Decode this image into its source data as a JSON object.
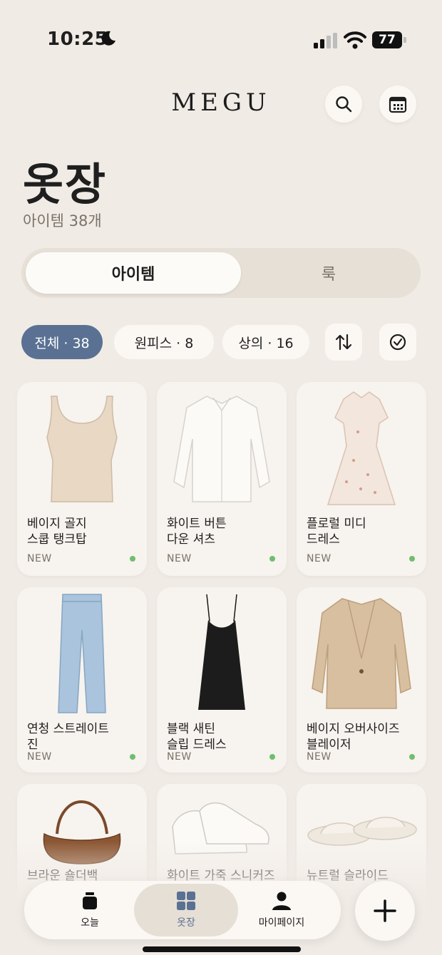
{
  "status": {
    "time": "10:25",
    "battery": "77",
    "moon_icon": "moon-icon",
    "signal_icon": "signal-icon",
    "wifi_icon": "wifi-icon"
  },
  "header": {
    "logo": "MEGU",
    "search_icon": "search-icon",
    "calendar_icon": "calendar-icon"
  },
  "page": {
    "title": "옷장",
    "subtitle": "아이템 38개"
  },
  "segment": {
    "options": [
      "아이템",
      "룩"
    ],
    "selected": "아이템"
  },
  "filters": {
    "chips": [
      {
        "label": "전체 · 38",
        "active": true
      },
      {
        "label": "원피스 · 8",
        "active": false
      },
      {
        "label": "상의 · 16",
        "active": false
      }
    ],
    "sort_icon": "sort-arrows-icon",
    "select_icon": "check-circle-icon"
  },
  "items": [
    {
      "name": "베이지 골지\n스쿱 탱크탑",
      "badge": "NEW",
      "icon": "tank-top-icon"
    },
    {
      "name": "화이트 버튼\n다운 셔츠",
      "badge": "NEW",
      "icon": "shirt-icon"
    },
    {
      "name": "플로럴 미디\n드레스",
      "badge": "NEW",
      "icon": "dress-icon"
    },
    {
      "name": "연청 스트레이트\n진",
      "badge": "NEW",
      "icon": "jeans-icon"
    },
    {
      "name": "블랙 새틴\n슬립 드레스",
      "badge": "NEW",
      "icon": "slip-dress-icon"
    },
    {
      "name": "베이지 오버사이즈\n블레이저",
      "badge": "NEW",
      "icon": "blazer-icon"
    },
    {
      "name": "브라운 숄더백",
      "badge": "",
      "icon": "shoulder-bag-icon"
    },
    {
      "name": "화이트 가죽 스니커즈",
      "badge": "",
      "icon": "sneakers-icon"
    },
    {
      "name": "뉴트럴 슬라이드\n샌들",
      "badge": "",
      "icon": "slide-sandals-icon"
    }
  ],
  "tabbar": {
    "tabs": [
      {
        "label": "오늘",
        "icon": "today-icon"
      },
      {
        "label": "옷장",
        "icon": "closet-grid-icon",
        "active": true
      },
      {
        "label": "마이페이지",
        "icon": "profile-icon"
      }
    ],
    "add_icon": "plus-icon"
  },
  "colors": {
    "background": "#f0ebe5",
    "accent": "#5a7193",
    "new_dot": "#6fbe6f",
    "card": "#f7f3ee"
  }
}
